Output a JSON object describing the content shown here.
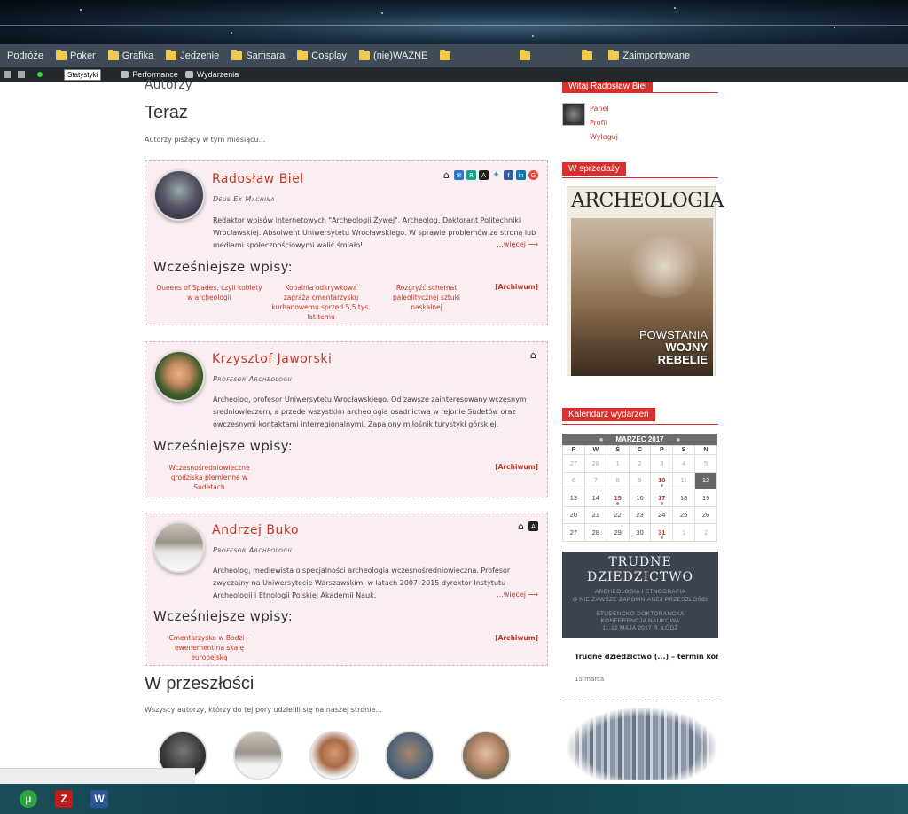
{
  "bookmarks": [
    "Podróże",
    "Poker",
    "Grafika",
    "Jedzenie",
    "Samsara",
    "Cosplay",
    "(nie)WAŻNE",
    "Zaimportowane"
  ],
  "adminbar": {
    "stats": "Statystyki",
    "performance": "Performance",
    "events": "Wydarzenia"
  },
  "page": {
    "crumb": "Autorzy",
    "now_heading": "Teraz",
    "now_sub": "Autorzy piszący w tym miesiącu...",
    "past_heading": "W przeszłości",
    "past_sub": "Wszyscy autorzy, którzy do tej pory udzielili się na naszej stronie..."
  },
  "authors": [
    {
      "name": "Radosław Biel",
      "role": "Deus Ex Machina",
      "bio": "Redaktor wpisów internetowych \"Archeologii Żywej\". Archeolog. Doktorant Politechniki Wrocławskiej. Absolwent Uniwersytetu Wrocławskiego. W sprawie problemów ze stroną lub mediami społecznościowymi walić śmiało!",
      "more": "...więcej ⟶",
      "earlier": "Wcześniejsze wpisy:",
      "posts": [
        "Queens of Spades, czyli kobiety w archeologii",
        "Kopalnia odkrywkowa zagraża cmentarzysku kurhanowemu sprzed 5,5 tys. lat temu",
        "Rozgryźć schemat paleolitycznej sztuki naskalnej"
      ],
      "archive": "[Archiwum]",
      "icons": [
        "home-icon",
        "mail-icon",
        "researchgate-icon",
        "academia-icon",
        "twitter-icon",
        "facebook-icon",
        "linkedin-icon",
        "googleplus-icon"
      ]
    },
    {
      "name": "Krzysztof Jaworski",
      "role": "Profesor Archeologii",
      "bio": "Archeolog, profesor Uniwersytetu Wrocławskiego. Od zawsze zainteresowany wczesnym średniowieczem, a przede wszystkim archeologią osadnictwa w rejonie Sudetów oraz ówczesnymi kontaktami interregionalnymi. Zapalony miłośnik turystyki górskiej.",
      "earlier": "Wcześniejsze wpisy:",
      "posts": [
        "Wczesnośredniowieczne grodziska plemienne w Sudetach"
      ],
      "archive": "[Archiwum]",
      "icons": [
        "home-icon"
      ]
    },
    {
      "name": "Andrzej Buko",
      "role": "Profesor Archeologii",
      "bio": "Archeolog, mediewista o specjalności archeologia wczesnośredniowieczna. Profesor zwyczajny na Uniwersytecie Warszawskim; w latach 2007–2015 dyrektor Instytutu Archeologii i Etnologii Polskiej Akademii Nauk.",
      "more": "...więcej ⟶",
      "earlier": "Wcześniejsze wpisy:",
      "posts": [
        "Cmentarzysko w Bodzi – ewenement na skalę europejską"
      ],
      "archive": "[Archiwum]",
      "icons": [
        "home-icon",
        "academia-icon"
      ]
    }
  ],
  "sidebar": {
    "welcome": "Witaj Radosław Biel",
    "links": [
      "Panel",
      "Profil",
      "Wyloguj"
    ],
    "sale_title": "W sprzedaży",
    "magazine": {
      "title": "ARCHEOLOGIA",
      "lines": [
        "POWSTANIA",
        "WOJNY",
        "REBELIE"
      ]
    },
    "calendar_title": "Kalendarz wydarzeń",
    "calendar": {
      "prev": "«",
      "month": "MARZEC 2017",
      "next": "»",
      "days": [
        "P",
        "W",
        "Ś",
        "C",
        "P",
        "S",
        "N"
      ],
      "weeks": [
        [
          "27",
          "28",
          "1",
          "2",
          "3",
          "4",
          "5"
        ],
        [
          "6",
          "7",
          "8",
          "9",
          "10",
          "11",
          "12"
        ],
        [
          "13",
          "14",
          "15",
          "16",
          "17",
          "18",
          "19"
        ],
        [
          "20",
          "21",
          "22",
          "23",
          "24",
          "25",
          "26"
        ],
        [
          "27",
          "28",
          "29",
          "30",
          "31",
          "1",
          "2"
        ]
      ],
      "event_days": [
        "10",
        "15",
        "17",
        "31"
      ],
      "today": "12"
    },
    "banner": {
      "line1": "TRUDNE",
      "line2": "DZIEDZICTWO",
      "line3": "ARCHEOLOGIA I ETNOGRAFIA",
      "line4": "O NIE ZAWSZE ZAPOMNIANEJ PRZESZŁOŚCI",
      "line5": "STUDENCKO-DOKTORANCKA",
      "line6": "KONFERENCJA NAUKOWA",
      "line7": "11-12 MAJA 2017 R. ŁÓDŹ"
    },
    "event_title": "Trudne dziedzictwo (...) – termin końcowy",
    "event_date": "15 marca"
  },
  "taskbar": [
    "utorrent-icon",
    "filezilla-icon",
    "word-icon"
  ],
  "colors": {
    "accent": "#c0392b",
    "widget": "#d9302e",
    "card_bg": "#fbeef0"
  }
}
